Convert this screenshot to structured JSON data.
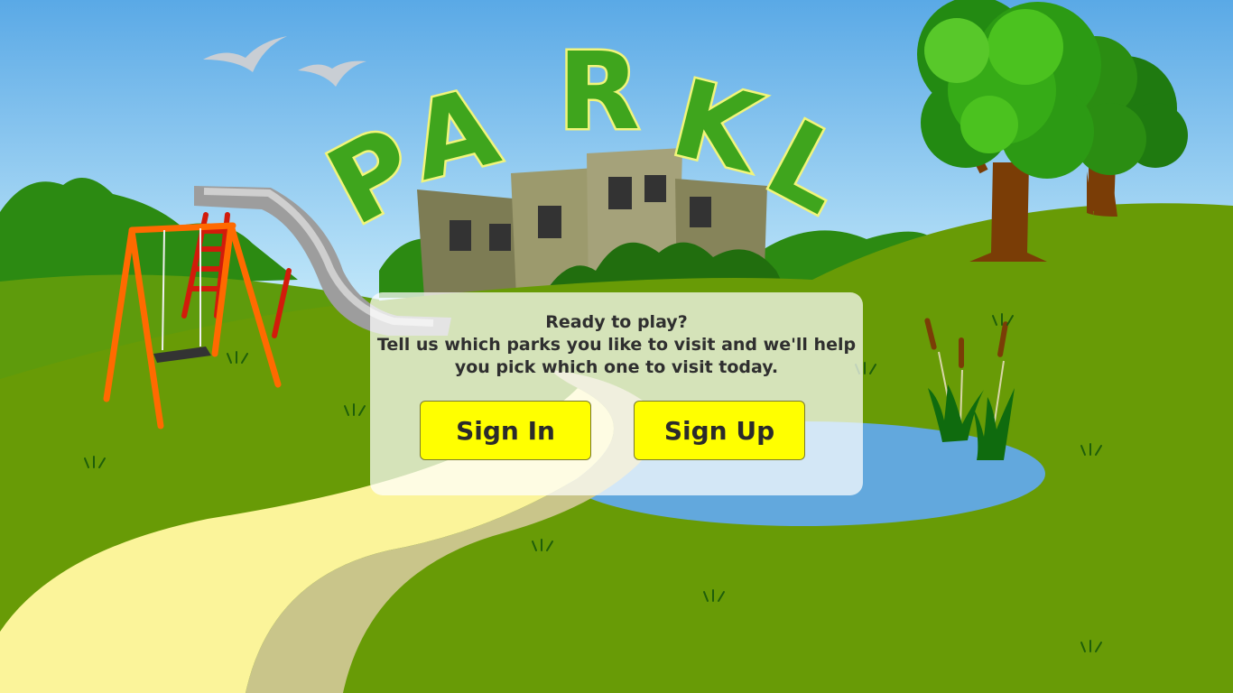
{
  "app": {
    "logo_text": [
      "P",
      "A",
      "R",
      "K",
      "L"
    ]
  },
  "welcome": {
    "heading": "Ready to play?",
    "line1": "Tell us which parks you like to visit and we'll help",
    "line2": "you pick which one to visit today."
  },
  "actions": {
    "sign_in_label": "Sign In",
    "sign_up_label": "Sign Up"
  },
  "theme": {
    "button_color": "#ffff00",
    "logo_fill": "#3fa51d",
    "logo_outline": "#f2f57a",
    "grass": "#6a9a08",
    "sky": "#8fd0f2"
  }
}
